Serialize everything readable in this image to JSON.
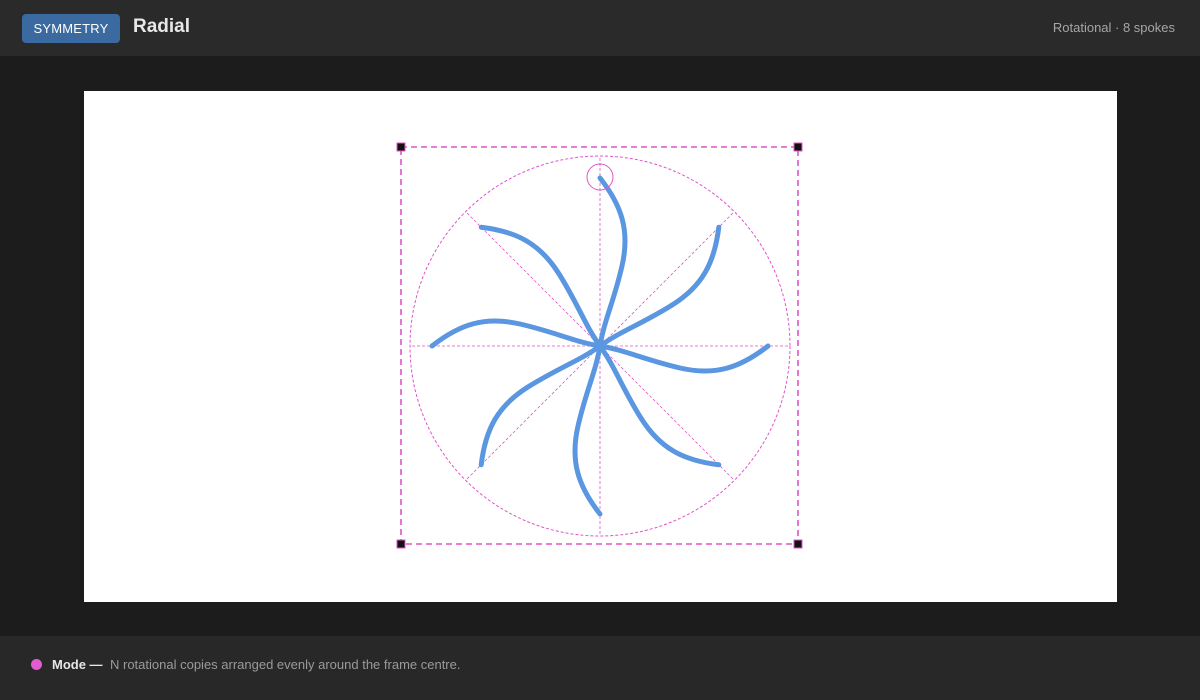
{
  "header": {
    "mode_badge": "SYMMETRY",
    "title": "Radial",
    "status": "Rotational · 8 spokes"
  },
  "symmetry": {
    "type": "rotational",
    "spokes": 8
  },
  "colors": {
    "stroke": "#5a97e0",
    "guide": "#e055c8",
    "handle": "#111111",
    "badge": "#3a6a9f"
  },
  "footer": {
    "legend_label": "Mode —",
    "legend_text": "N rotational copies arranged evenly around the frame centre."
  }
}
